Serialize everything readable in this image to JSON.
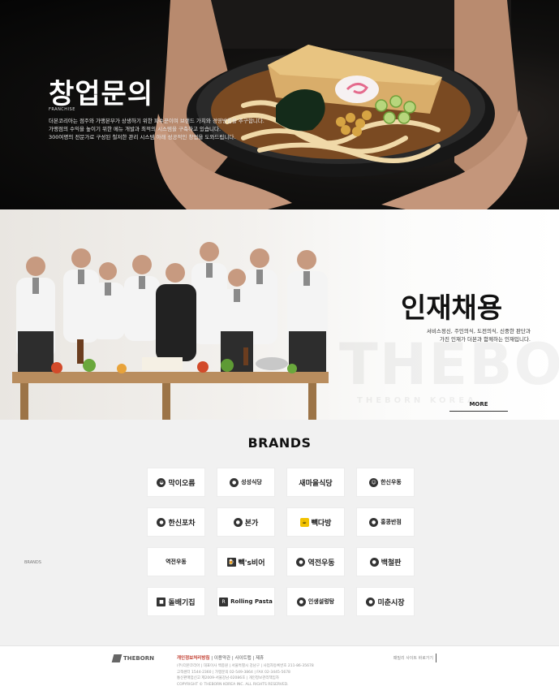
{
  "franchise": {
    "title": "창업문의",
    "sub": "FRANCHISE",
    "desc_lines": [
      "더본코리아는 점주와 가맹본부가 상생하기 위한 파수꾼이며 브랜드 가치와 경영방침을 추구합니다.",
      "가맹점의 수익을 높이기 위한 메뉴 개발과 최적의 시스템을 구축하고 있습니다.",
      "300여명의 전문가로 구성된 철저한 관리 시스템 아래 성공적인 창업을 도와드립니다."
    ]
  },
  "recruit": {
    "title": "인재채용",
    "desc_lines": [
      "서비스정신, 주인의식, 도전의식, 신중한 판단과",
      "가진 인재가 더본과 함께하는 인재입니다."
    ],
    "more_label": "MORE",
    "watermark": "THEBORN",
    "watermark_sub": "THEBORN KOREA"
  },
  "brands": {
    "title": "BRANDS",
    "side_label": "BRANDS",
    "items": [
      {
        "name": "막이오름",
        "icon": "mask-icon"
      },
      {
        "name": "성성식당",
        "icon": "circle-logo-icon"
      },
      {
        "name": "새마을식당",
        "icon": ""
      },
      {
        "name": "한신우동",
        "icon": "chef-face-icon"
      },
      {
        "name": "한신포차",
        "icon": "circle-logo-icon"
      },
      {
        "name": "본가",
        "icon": "circle-logo-icon"
      },
      {
        "name": "빽다방",
        "icon": "paiks-coffee-icon"
      },
      {
        "name": "홍콩반점",
        "icon": "circle-logo-icon"
      },
      {
        "name": "역전우동",
        "icon": ""
      },
      {
        "name": "빽's비어",
        "icon": "beer-icon"
      },
      {
        "name": "역전우동",
        "icon": "circle-logo-icon"
      },
      {
        "name": "백철판",
        "icon": "circle-logo-icon"
      },
      {
        "name": "돌배기집",
        "icon": "square-logo-icon"
      },
      {
        "name": "Rolling Pasta",
        "icon": "r-logo-icon"
      },
      {
        "name": "인생설렁탕",
        "icon": "circle-logo-icon"
      },
      {
        "name": "미춘시장",
        "icon": "circle-logo-icon"
      }
    ]
  },
  "footer": {
    "logo": "THEBORN",
    "links_highlight": "개인정보처리방침",
    "links": [
      "이용약관",
      "사이트맵",
      "제휴"
    ],
    "info_lines": [
      "(주)더본코리아 | 대표이사 백종원 | 서울특별시 강남구 | 사업자등록번호 211-86-35678",
      "고객센터 1544-2360 | 가맹문의 02-549-3864 | FAX 02-3445-5678",
      "통신판매업신고 제2009-서울강남-02086호 | 개인정보관리책임자",
      "COPYRIGHT © THEBORN KOREA INC. ALL RIGHTS RESERVED."
    ],
    "family_site": "패밀리 사이트 바로가기"
  }
}
